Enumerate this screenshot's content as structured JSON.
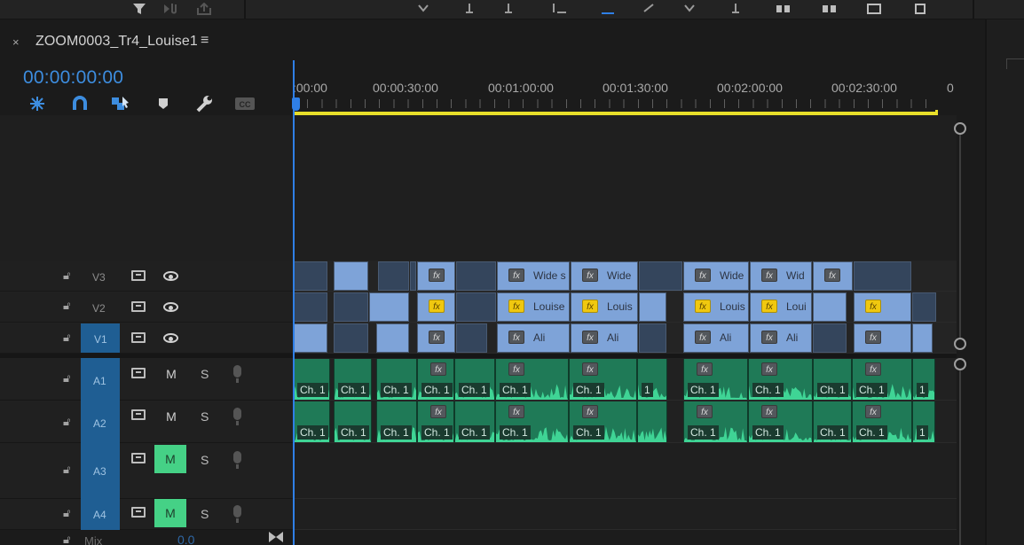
{
  "sequence": {
    "title": "ZOOM0003_Tr4_Louise1",
    "close_glyph": "×",
    "menu_glyph": "≡",
    "timecode": "00:00:00:00"
  },
  "toolbar_icons": [
    "insert-icon",
    "snap-magnet-icon",
    "linked-selection-icon",
    "add-marker-icon",
    "wrench-settings-icon",
    "closed-captions-icon"
  ],
  "ruler": {
    "labels": [
      ":00:00",
      "00:00:30:00",
      "00:01:00:00",
      "00:01:30:00",
      "00:02:00:00",
      "00:02:30:00",
      "0"
    ]
  },
  "video_tracks": [
    {
      "name": "V3",
      "targeted": false
    },
    {
      "name": "V2",
      "targeted": false
    },
    {
      "name": "V1",
      "targeted": true
    }
  ],
  "audio_tracks": [
    {
      "name": "A1",
      "m": "M",
      "s": "S",
      "m_on": false
    },
    {
      "name": "A2",
      "m": "M",
      "s": "S",
      "m_on": false
    },
    {
      "name": "A3",
      "m": "M",
      "s": "S",
      "m_on": true
    },
    {
      "name": "A4",
      "m": "M",
      "s": "S",
      "m_on": true
    }
  ],
  "clips": {
    "v3": [
      {
        "fx": false,
        "label": "",
        "dark": true
      },
      {
        "fx": false,
        "label": "",
        "dark": false
      },
      {
        "fx": false,
        "label": "",
        "dark": true
      },
      {
        "fx": false,
        "label": "",
        "dark": true
      },
      {
        "fx": true,
        "label": "",
        "dark": false
      },
      {
        "fx": false,
        "label": "",
        "dark": true
      },
      {
        "fx": true,
        "label": "Wide s",
        "dark": false
      },
      {
        "fx": true,
        "label": "Wide",
        "dark": false
      },
      {
        "fx": false,
        "label": "",
        "dark": true
      },
      {
        "fx": true,
        "label": "Wide",
        "dark": false
      },
      {
        "fx": true,
        "label": "Wid",
        "dark": false
      },
      {
        "fx": true,
        "label": "",
        "dark": false
      },
      {
        "fx": false,
        "label": "",
        "dark": true
      }
    ],
    "v2": [
      {
        "fx": false,
        "label": "",
        "dark": true
      },
      {
        "fx": false,
        "label": "",
        "dark": true
      },
      {
        "fx": false,
        "label": "",
        "dark": false
      },
      {
        "fx": "yellow",
        "label": "",
        "dark": false
      },
      {
        "fx": false,
        "label": "",
        "dark": true
      },
      {
        "fx": "yellow",
        "label": "Louise",
        "dark": false
      },
      {
        "fx": "yellow",
        "label": "Louis",
        "dark": false
      },
      {
        "fx": false,
        "label": "",
        "dark": false
      },
      {
        "fx": "yellow",
        "label": "Louis",
        "dark": false
      },
      {
        "fx": "yellow",
        "label": "Loui",
        "dark": false
      },
      {
        "fx": false,
        "label": "",
        "dark": false
      },
      {
        "fx": "yellow",
        "label": "",
        "dark": false
      },
      {
        "fx": false,
        "label": "",
        "dark": true
      }
    ],
    "v1": [
      {
        "fx": false,
        "label": "",
        "dark": false
      },
      {
        "fx": false,
        "label": "",
        "dark": true
      },
      {
        "fx": false,
        "label": "",
        "dark": false
      },
      {
        "fx": true,
        "label": "",
        "dark": false
      },
      {
        "fx": false,
        "label": "",
        "dark": true
      },
      {
        "fx": true,
        "label": "Ali",
        "dark": false
      },
      {
        "fx": true,
        "label": "Ali",
        "dark": false
      },
      {
        "fx": false,
        "label": "",
        "dark": true
      },
      {
        "fx": true,
        "label": "Ali",
        "dark": false
      },
      {
        "fx": true,
        "label": "Ali",
        "dark": false
      },
      {
        "fx": false,
        "label": "",
        "dark": true
      },
      {
        "fx": true,
        "label": "",
        "dark": false
      },
      {
        "fx": false,
        "label": "",
        "dark": false
      }
    ],
    "a1": [
      {
        "fx": false,
        "label": "Ch. 1"
      },
      {
        "fx": false,
        "label": "Ch. 1"
      },
      {
        "fx": false,
        "label": "Ch. 1"
      },
      {
        "fx": true,
        "label": "Ch. 1"
      },
      {
        "fx": false,
        "label": "Ch. 1"
      },
      {
        "fx": true,
        "label": "Ch. 1"
      },
      {
        "fx": true,
        "label": "Ch. 1"
      },
      {
        "fx": false,
        "label": "1"
      },
      {
        "fx": true,
        "label": "Ch. 1"
      },
      {
        "fx": true,
        "label": "Ch. 1"
      },
      {
        "fx": false,
        "label": "Ch. 1"
      },
      {
        "fx": true,
        "label": "Ch. 1"
      },
      {
        "fx": false,
        "label": "1"
      }
    ],
    "a2": [
      {
        "fx": false,
        "label": "Ch. 1"
      },
      {
        "fx": false,
        "label": "Ch. 1"
      },
      {
        "fx": false,
        "label": "Ch. 1"
      },
      {
        "fx": true,
        "label": "Ch. 1"
      },
      {
        "fx": false,
        "label": "Ch. 1"
      },
      {
        "fx": true,
        "label": "Ch. 1"
      },
      {
        "fx": true,
        "label": "Ch. 1"
      },
      {
        "fx": false,
        "label": ""
      },
      {
        "fx": true,
        "label": "Ch. 1"
      },
      {
        "fx": true,
        "label": "Ch. 1"
      },
      {
        "fx": false,
        "label": "Ch. 1"
      },
      {
        "fx": true,
        "label": "Ch. 1"
      },
      {
        "fx": false,
        "label": "1"
      }
    ]
  },
  "fx_text": "fx",
  "mix": {
    "label": "Mix",
    "value": "0.0"
  },
  "colors": {
    "accent": "#2f7fe6",
    "work_area": "#e8df2a",
    "video_clip": "#7ea3d8",
    "audio_clip": "#1f7a57",
    "mute_on": "#45d186",
    "target": "#1f5e93"
  }
}
